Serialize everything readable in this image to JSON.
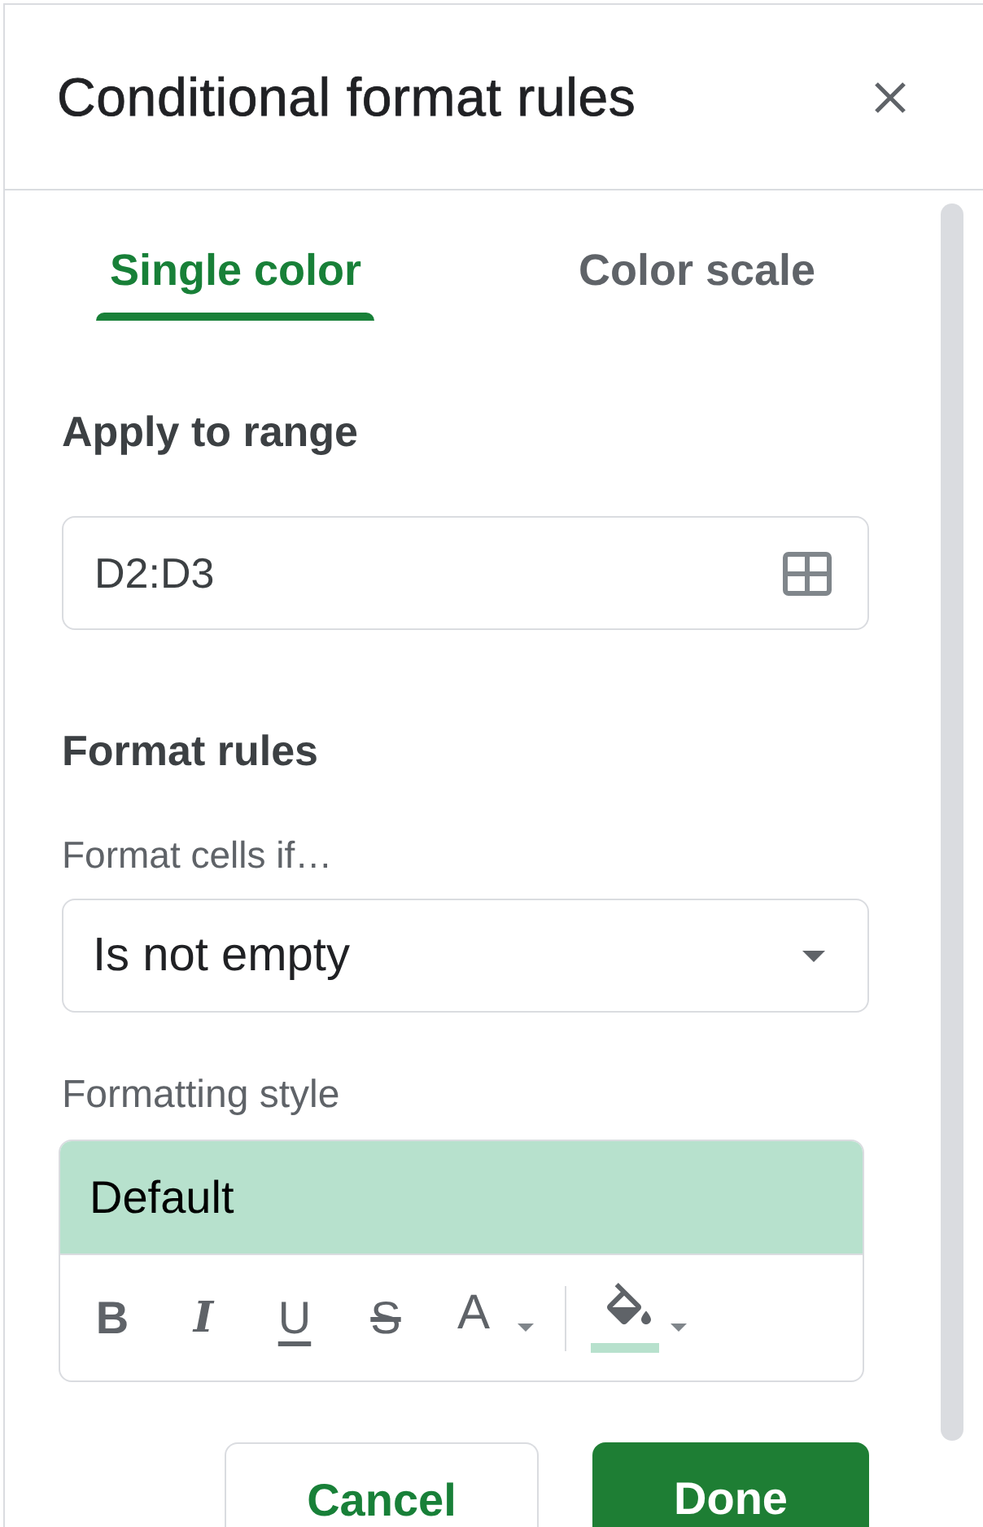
{
  "dialog": {
    "title": "Conditional format rules"
  },
  "tabs": [
    {
      "label": "Single color",
      "selected": true
    },
    {
      "label": "Color scale",
      "selected": false
    }
  ],
  "apply_to_range": {
    "heading": "Apply to range",
    "value": "D2:D3"
  },
  "format_rules": {
    "heading": "Format rules",
    "condition_label": "Format cells if…",
    "condition": "Is not empty"
  },
  "formatting_style": {
    "label": "Formatting style",
    "preview": "Default",
    "tools": [
      {
        "kind": "bold",
        "label": "B"
      },
      {
        "kind": "italic",
        "label": "I"
      },
      {
        "kind": "underline",
        "label": "U"
      },
      {
        "kind": "strikethrough",
        "label": "S"
      },
      {
        "kind": "text_color",
        "label": "A"
      },
      {
        "kind": "fill_color",
        "color": "#b7e1cd"
      }
    ]
  },
  "buttons": [
    {
      "label": "Cancel",
      "kind": "secondary"
    },
    {
      "label": "Done",
      "kind": "primary"
    }
  ]
}
